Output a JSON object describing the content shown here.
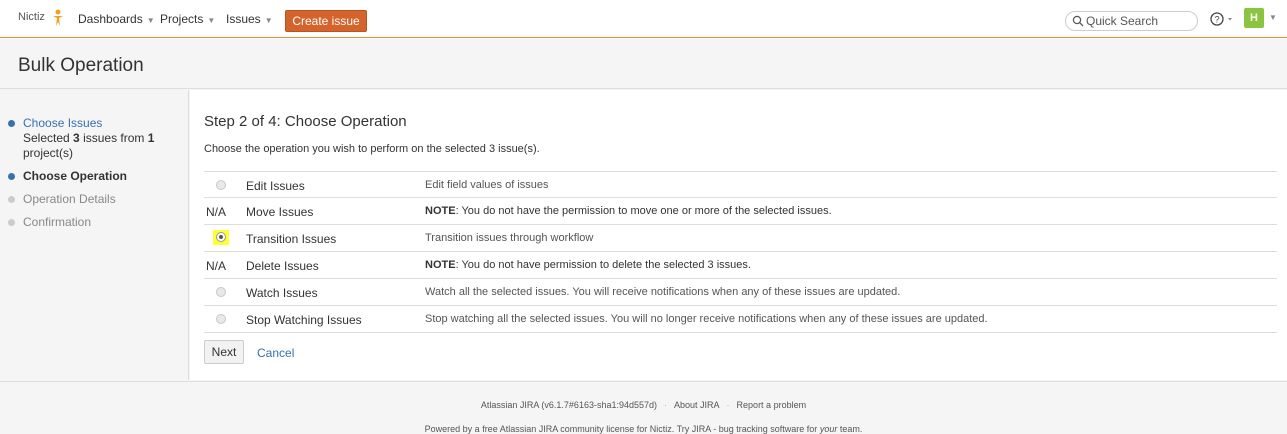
{
  "header": {
    "brand": "Nictiz",
    "nav": [
      {
        "label": "Dashboards"
      },
      {
        "label": "Projects"
      },
      {
        "label": "Issues"
      }
    ],
    "create_label": "Create issue",
    "search_placeholder": "Quick Search",
    "avatar_letter": "H"
  },
  "page": {
    "title": "Bulk Operation"
  },
  "sidebar": {
    "step1_link": "Choose Issues",
    "step1_detail_a": "Selected ",
    "step1_count": "3",
    "step1_detail_b": " issues from ",
    "step1_projects": "1",
    "step1_detail_c": "project(s)",
    "step2": "Choose Operation",
    "step3": "Operation Details",
    "step4": "Confirmation"
  },
  "main": {
    "step_title": "Step 2 of 4: Choose Operation",
    "description": "Choose the operation you wish to perform on the selected 3 issue(s).",
    "operations": [
      {
        "state": "radio",
        "name": "Edit Issues",
        "desc": "Edit field values of issues"
      },
      {
        "state": "N/A",
        "name": "Move Issues",
        "note": "NOTE",
        "desc": ": You do not have the permission to move one or more of the selected issues."
      },
      {
        "state": "selected",
        "name": "Transition Issues",
        "desc": "Transition issues through workflow"
      },
      {
        "state": "N/A",
        "name": "Delete Issues",
        "note": "NOTE",
        "desc": ": You do not have permission to delete the selected 3 issues."
      },
      {
        "state": "radio",
        "name": "Watch Issues",
        "desc": "Watch all the selected issues. You will receive notifications when any of these issues are updated."
      },
      {
        "state": "radio",
        "name": "Stop Watching Issues",
        "desc": "Stop watching all the selected issues. You will no longer receive notifications when any of these issues are updated."
      }
    ],
    "next_label": "Next",
    "cancel_label": "Cancel"
  },
  "footer": {
    "version": "Atlassian JIRA (v6.1.7#6163-sha1:94d557d)",
    "about": "About JIRA",
    "report": "Report a problem",
    "powered_a": "Powered by a free Atlassian JIRA community license for Nictiz. Try JIRA - bug tracking software for ",
    "powered_your": "your",
    "powered_b": " team."
  }
}
